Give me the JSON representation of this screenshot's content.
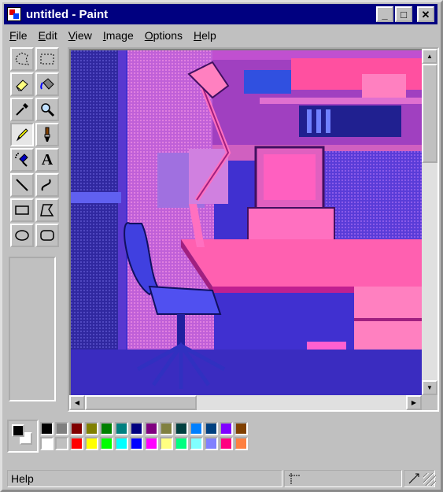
{
  "window": {
    "title": "untitled - Paint"
  },
  "title_buttons": {
    "minimize": "_",
    "maximize": "□",
    "close": "✕"
  },
  "menu": [
    {
      "underline": "F",
      "rest": "ile"
    },
    {
      "underline": "E",
      "rest": "dit"
    },
    {
      "underline": "V",
      "rest": "iew"
    },
    {
      "underline": "I",
      "rest": "mage"
    },
    {
      "underline": "O",
      "rest": "ptions"
    },
    {
      "underline": "H",
      "rest": "elp"
    }
  ],
  "tools": [
    {
      "name": "free-form-select",
      "icon": "free-form-select-icon"
    },
    {
      "name": "select",
      "icon": "select-icon"
    },
    {
      "name": "eraser",
      "icon": "eraser-icon"
    },
    {
      "name": "fill-with-color",
      "icon": "paint-bucket-icon"
    },
    {
      "name": "pick-color",
      "icon": "eyedropper-icon"
    },
    {
      "name": "magnifier",
      "icon": "magnifier-icon"
    },
    {
      "name": "pencil",
      "icon": "pencil-icon",
      "active": true
    },
    {
      "name": "brush",
      "icon": "brush-icon"
    },
    {
      "name": "airbrush",
      "icon": "airbrush-icon"
    },
    {
      "name": "text",
      "icon": "text-icon",
      "glyph": "A"
    },
    {
      "name": "line",
      "icon": "line-icon"
    },
    {
      "name": "curve",
      "icon": "curve-icon"
    },
    {
      "name": "rectangle",
      "icon": "rectangle-icon"
    },
    {
      "name": "polygon",
      "icon": "polygon-icon"
    },
    {
      "name": "ellipse",
      "icon": "ellipse-icon"
    },
    {
      "name": "rounded-rectangle",
      "icon": "rounded-rectangle-icon"
    }
  ],
  "palette": {
    "foreground": "#000000",
    "background": "#ffffff",
    "top_row": [
      "#000000",
      "#808080",
      "#800000",
      "#808000",
      "#008000",
      "#008080",
      "#000080",
      "#800080",
      "#808040",
      "#004040",
      "#0080ff",
      "#004080",
      "#8000ff",
      "#804000"
    ],
    "bottom_row": [
      "#ffffff",
      "#c0c0c0",
      "#ff0000",
      "#ffff00",
      "#00ff00",
      "#00ffff",
      "#0000ff",
      "#ff00ff",
      "#ffff80",
      "#00ff80",
      "#80ffff",
      "#8080ff",
      "#ff0080",
      "#ff8040"
    ]
  },
  "scrollbars": {
    "up": "▲",
    "down": "▼",
    "left": "◀",
    "right": "▶"
  },
  "status": {
    "text": "Help"
  }
}
